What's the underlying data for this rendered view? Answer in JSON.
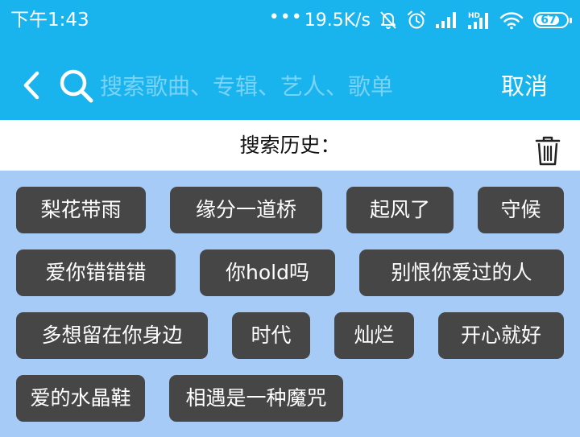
{
  "status_bar": {
    "time": "下午1:43",
    "dots": "•••",
    "network_speed": "19.5K/s",
    "battery_level": "67",
    "signal_tag": "HD"
  },
  "search": {
    "placeholder": "搜索歌曲、专辑、艺人、歌单",
    "cancel_label": "取消"
  },
  "history": {
    "title": "搜索历史：",
    "tags": [
      "梨花带雨",
      "缘分一道桥",
      "起风了",
      "守候",
      "爱你错错错",
      "你hold吗",
      "别恨你爱过的人",
      "多想留在你身边",
      "时代",
      "灿烂",
      "开心就好",
      "爱的水晶鞋",
      "相遇是一种魔咒"
    ]
  },
  "colors": {
    "header_bg": "#19b3ee",
    "content_bg": "#a7cbf7",
    "tag_bg": "#464646",
    "tag_text": "#ffffff"
  },
  "icons": {
    "back": "chevron-left-icon",
    "search": "search-icon",
    "trash": "trash-icon"
  }
}
